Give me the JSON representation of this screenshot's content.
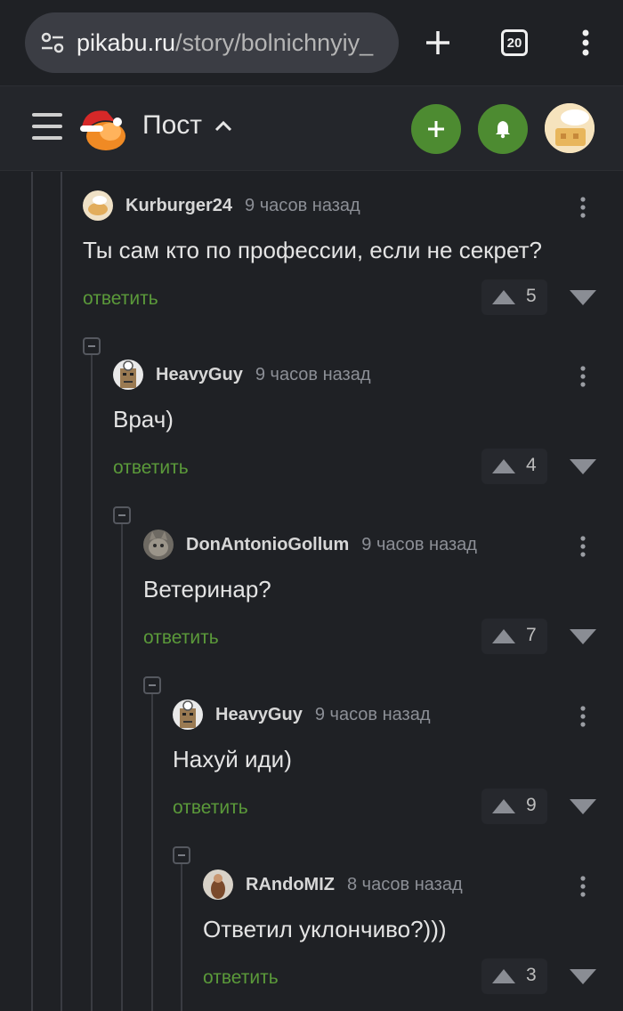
{
  "browser": {
    "url_host": "pikabu.ru",
    "url_path": "/story/bolnichnyiy_",
    "tab_count": "20"
  },
  "header": {
    "title": "Пост"
  },
  "colors": {
    "background": "#1f2125",
    "accent_green": "#4d8b31",
    "reply_green": "#5b9a3a"
  },
  "comments": [
    {
      "author": "Kurburger24",
      "time": "9 часов назад",
      "text": "Ты сам кто по профессии, если не секрет?",
      "reply": "ответить",
      "rating": "5",
      "avatar": "bread-avatar"
    },
    {
      "author": "HeavyGuy",
      "time": "9 часов назад",
      "text": "Врач)",
      "reply": "ответить",
      "rating": "4",
      "avatar": "doctor-avatar"
    },
    {
      "author": "DonAntonioGollum",
      "time": "9 часов назад",
      "text": "Ветеринар?",
      "reply": "ответить",
      "rating": "7",
      "avatar": "cat-avatar"
    },
    {
      "author": "HeavyGuy",
      "time": "9 часов назад",
      "text": "Нахуй иди)",
      "reply": "ответить",
      "rating": "9",
      "avatar": "doctor-avatar"
    },
    {
      "author": "RAndoMIZ",
      "time": "8 часов назад",
      "text": "Ответил уклончиво?)))",
      "reply": "ответить",
      "rating": "3",
      "avatar": "photo-avatar"
    }
  ]
}
